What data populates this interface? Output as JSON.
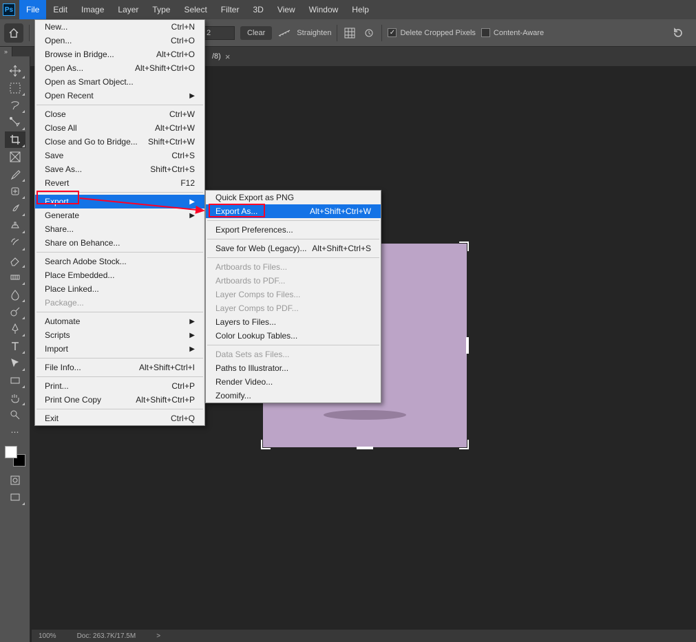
{
  "menubar": {
    "items": [
      "File",
      "Edit",
      "Image",
      "Layer",
      "Type",
      "Select",
      "Filter",
      "3D",
      "View",
      "Window",
      "Help"
    ],
    "activeIndex": 0
  },
  "optionsbar": {
    "ratio_a": "",
    "ratio_b": "2",
    "clear": "Clear",
    "straighten": "Straighten",
    "delete_cropped": "Delete Cropped Pixels",
    "content_aware": "Content-Aware"
  },
  "document_tab": {
    "fragment": "/8)",
    "close": "×"
  },
  "file_menu": [
    {
      "label": "New...",
      "shortcut": "Ctrl+N"
    },
    {
      "label": "Open...",
      "shortcut": "Ctrl+O"
    },
    {
      "label": "Browse in Bridge...",
      "shortcut": "Alt+Ctrl+O"
    },
    {
      "label": "Open As...",
      "shortcut": "Alt+Shift+Ctrl+O"
    },
    {
      "label": "Open as Smart Object..."
    },
    {
      "label": "Open Recent",
      "arrow": true
    },
    {
      "sep": true
    },
    {
      "label": "Close",
      "shortcut": "Ctrl+W"
    },
    {
      "label": "Close All",
      "shortcut": "Alt+Ctrl+W"
    },
    {
      "label": "Close and Go to Bridge...",
      "shortcut": "Shift+Ctrl+W"
    },
    {
      "label": "Save",
      "shortcut": "Ctrl+S"
    },
    {
      "label": "Save As...",
      "shortcut": "Shift+Ctrl+S"
    },
    {
      "label": "Revert",
      "shortcut": "F12"
    },
    {
      "sep": true
    },
    {
      "label": "Export",
      "arrow": true,
      "hover": true
    },
    {
      "label": "Generate",
      "arrow": true
    },
    {
      "label": "Share..."
    },
    {
      "label": "Share on Behance..."
    },
    {
      "sep": true
    },
    {
      "label": "Search Adobe Stock..."
    },
    {
      "label": "Place Embedded..."
    },
    {
      "label": "Place Linked..."
    },
    {
      "label": "Package...",
      "disabled": true
    },
    {
      "sep": true
    },
    {
      "label": "Automate",
      "arrow": true
    },
    {
      "label": "Scripts",
      "arrow": true
    },
    {
      "label": "Import",
      "arrow": true
    },
    {
      "sep": true
    },
    {
      "label": "File Info...",
      "shortcut": "Alt+Shift+Ctrl+I"
    },
    {
      "sep": true
    },
    {
      "label": "Print...",
      "shortcut": "Ctrl+P"
    },
    {
      "label": "Print One Copy",
      "shortcut": "Alt+Shift+Ctrl+P"
    },
    {
      "sep": true
    },
    {
      "label": "Exit",
      "shortcut": "Ctrl+Q"
    }
  ],
  "export_submenu": [
    {
      "label": "Quick Export as PNG"
    },
    {
      "label": "Export As...",
      "shortcut": "Alt+Shift+Ctrl+W",
      "hover": true
    },
    {
      "sep": true
    },
    {
      "label": "Export Preferences..."
    },
    {
      "sep": true
    },
    {
      "label": "Save for Web (Legacy)...",
      "shortcut": "Alt+Shift+Ctrl+S"
    },
    {
      "sep": true
    },
    {
      "label": "Artboards to Files...",
      "disabled": true
    },
    {
      "label": "Artboards to PDF...",
      "disabled": true
    },
    {
      "label": "Layer Comps to Files...",
      "disabled": true
    },
    {
      "label": "Layer Comps to PDF...",
      "disabled": true
    },
    {
      "label": "Layers to Files..."
    },
    {
      "label": "Color Lookup Tables..."
    },
    {
      "sep": true
    },
    {
      "label": "Data Sets as Files...",
      "disabled": true
    },
    {
      "label": "Paths to Illustrator..."
    },
    {
      "label": "Render Video..."
    },
    {
      "label": "Zoomify..."
    }
  ],
  "statusbar": {
    "zoom": "100%",
    "doc": "Doc: 263.7K/17.5M",
    "arrow": ">"
  },
  "tools": [
    "move-tool",
    "artboard-tool",
    "lasso-tool",
    "quick-select-tool",
    "crop-tool",
    "frame-tool",
    "eyedropper-tool",
    "healing-brush-tool",
    "brush-tool",
    "clone-stamp-tool",
    "history-brush-tool",
    "eraser-tool",
    "gradient-tool",
    "blur-tool",
    "dodge-tool",
    "pen-tool",
    "type-tool",
    "path-select-tool",
    "rectangle-tool",
    "hand-tool",
    "zoom-tool",
    "more-tool"
  ]
}
